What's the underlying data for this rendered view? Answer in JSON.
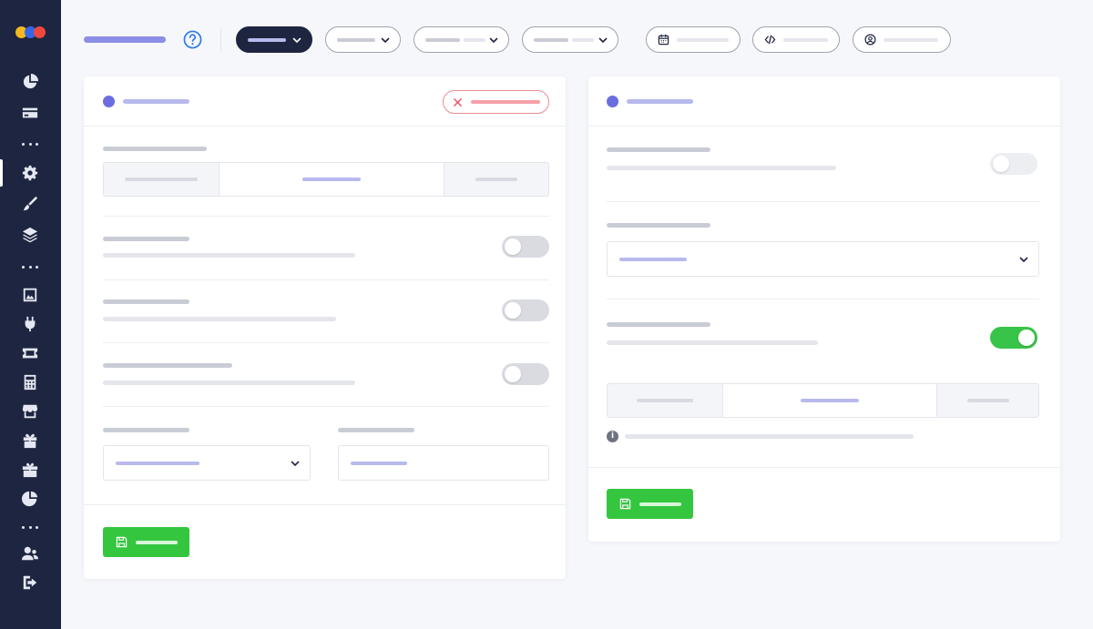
{
  "colors": {
    "sidebar_bg": "#1e2540",
    "accent": "#6b6ee0",
    "success": "#35c63f",
    "danger": "#f08a94",
    "logo": [
      "#f6b720",
      "#3566e6",
      "#f0473c"
    ]
  },
  "sidebar": {
    "icons": [
      {
        "name": "pie-chart-icon"
      },
      {
        "name": "credit-card-icon"
      },
      {
        "name": "more-dots-icon"
      },
      {
        "name": "gear-icon",
        "active": true
      },
      {
        "name": "brush-icon"
      },
      {
        "name": "layers-icon"
      },
      {
        "name": "more-dots-icon"
      },
      {
        "name": "image-frame-icon"
      },
      {
        "name": "plug-icon"
      },
      {
        "name": "ticket-icon"
      },
      {
        "name": "calculator-icon"
      },
      {
        "name": "store-icon"
      },
      {
        "name": "gift-icon"
      },
      {
        "name": "gift-box-icon"
      },
      {
        "name": "pie-chart-alt-icon"
      },
      {
        "name": "more-dots-icon"
      },
      {
        "name": "users-icon"
      },
      {
        "name": "logout-icon"
      }
    ]
  },
  "topbar": {
    "help_icon": "question-circle-icon",
    "filters": [
      {
        "name": "filter-1",
        "active": true
      },
      {
        "name": "filter-2"
      },
      {
        "name": "filter-3"
      },
      {
        "name": "filter-4"
      },
      {
        "name": "date-range",
        "icon": "calendar-icon"
      },
      {
        "name": "embed-code",
        "icon": "code-icon"
      },
      {
        "name": "account",
        "icon": "user-circle-icon"
      }
    ]
  },
  "left_card": {
    "reset_icon": "close-x-icon",
    "segment_active_index": 1,
    "toggles": [
      false,
      false,
      false
    ],
    "save_icon": "floppy-disk-icon"
  },
  "right_card": {
    "toggles": [
      false,
      true
    ],
    "segment_active_index": 1,
    "info_glyph": "i",
    "info_icon": "info-icon",
    "save_icon": "floppy-disk-icon"
  }
}
